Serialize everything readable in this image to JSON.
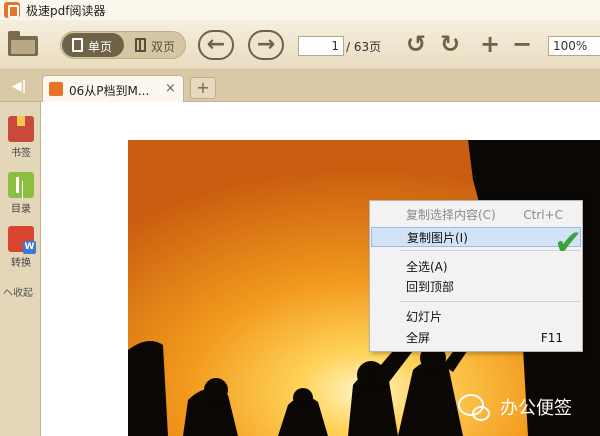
{
  "app": {
    "title": "极速pdf阅读器"
  },
  "toolbar": {
    "view_single": "单页",
    "view_double": "双页",
    "back_glyph": "←",
    "forward_glyph": "→",
    "page_current": "1",
    "page_total": "/ 63页",
    "rotate_left_glyph": "↺",
    "rotate_right_glyph": "↻",
    "zoom_in_glyph": "+",
    "zoom_out_glyph": "−",
    "zoom_value": "100%"
  },
  "tabs": {
    "collapse_glyph": "◀|",
    "items": [
      {
        "label": "06从P档到M...",
        "close": "×"
      }
    ],
    "new_tab": "+"
  },
  "sidebar": {
    "items": [
      {
        "label": "书签",
        "icon": "bookmark-icon"
      },
      {
        "label": "目录",
        "icon": "toc-icon"
      },
      {
        "label": "转换",
        "icon": "convert-icon"
      }
    ],
    "fold_label": "ヘ收起"
  },
  "context_menu": {
    "items": [
      {
        "label": "复制选择内容(C)",
        "shortcut": "Ctrl+C",
        "state": "disabled"
      },
      {
        "label": "复制图片(I)",
        "shortcut": "",
        "state": "highlighted"
      },
      {
        "label": "全选(A)",
        "shortcut": "",
        "state": "normal"
      },
      {
        "label": "回到顶部",
        "shortcut": "",
        "state": "normal"
      },
      {
        "label": "幻灯片",
        "shortcut": "",
        "state": "normal"
      },
      {
        "label": "全屏",
        "shortcut": "F11",
        "state": "normal"
      }
    ]
  },
  "annotation": {
    "check_glyph": "✔",
    "check_color": "#3aa33a"
  },
  "watermark": {
    "text": "办公便签",
    "icon": "wechat-icon"
  },
  "colors": {
    "accent": "#e8742a",
    "toolbar_dark": "#6e6249",
    "menu_highlight": "#d3e3f7",
    "photo_orange": "#e0861e"
  }
}
